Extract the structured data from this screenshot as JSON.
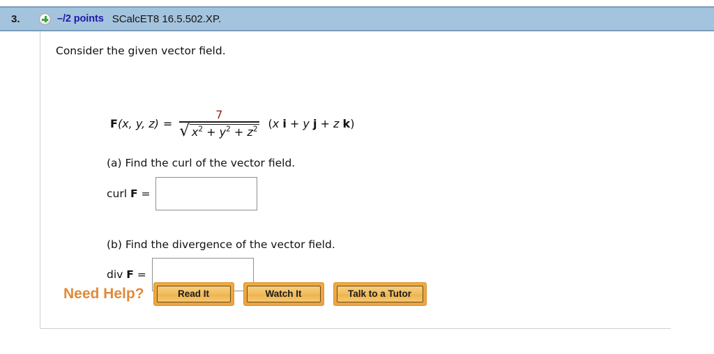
{
  "header": {
    "question_number": "3.",
    "expand_icon": "plus-circle-icon",
    "points": "–/2 points",
    "question_code": "SCalcET8 16.5.502.XP.",
    "bar_color": "#a4c3dd",
    "points_color": "#1a1aa8"
  },
  "body": {
    "intro": "Consider the given vector field.",
    "formula": {
      "function_name": "F",
      "arguments": "(x, y, z)",
      "equals": "=",
      "numerator": "7",
      "numerator_color": "#a01818",
      "radical": "√",
      "denominator_terms": [
        "x",
        "2",
        "+",
        "y",
        "2",
        "+",
        "z",
        "2"
      ],
      "denominator_plain": "x² + y² + z²",
      "vector_part": "(x i + y j + z k)",
      "vector_tokens": {
        "open": "(",
        "x": "x",
        "i": "i",
        "plus1": "+",
        "y": "y",
        "j": "j",
        "plus2": "+",
        "z": "z",
        "k": "k",
        "close": ")"
      }
    },
    "parts": [
      {
        "prompt": "(a) Find the curl of the vector field.",
        "answer_label_text": "curl ",
        "answer_label_bold": "F",
        "answer_label_equals": " =",
        "answer_value": "",
        "answer_placeholder": ""
      },
      {
        "prompt": "(b) Find the divergence of the vector field.",
        "answer_label_text": "div ",
        "answer_label_bold": "F",
        "answer_label_equals": " =",
        "answer_value": "",
        "answer_placeholder": ""
      }
    ]
  },
  "need_help": {
    "label": "Need Help?",
    "label_color": "#e08a3a",
    "buttons": [
      {
        "label": "Read It"
      },
      {
        "label": "Watch It"
      },
      {
        "label": "Talk to a Tutor"
      }
    ]
  }
}
